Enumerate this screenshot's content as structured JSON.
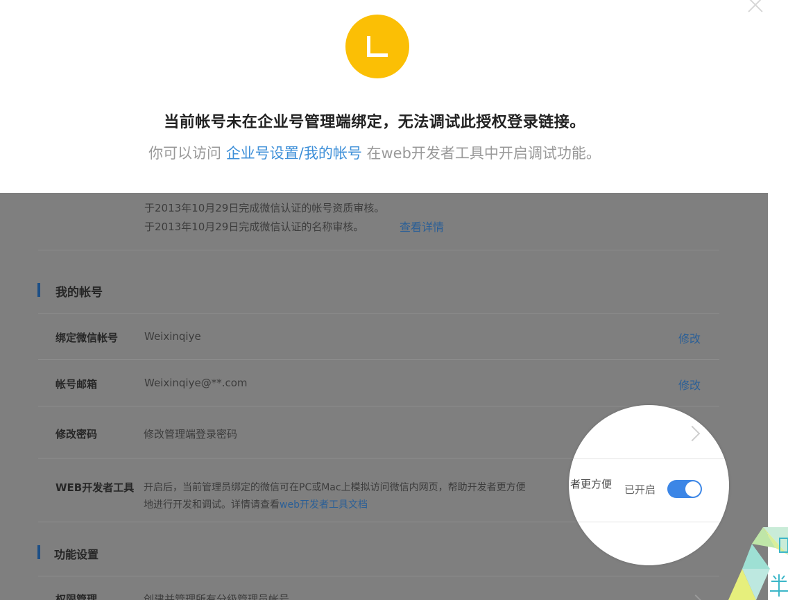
{
  "dialog": {
    "avatar_letter": "L",
    "main_message": "当前帐号未在企业号管理端绑定，无法调试此授权登录链接。",
    "sub_prefix": "你可以访问 ",
    "sub_link": "企业号设置/我的帐号",
    "sub_suffix": " 在web开发者工具中开启调试功能。"
  },
  "panel": {
    "cert_line1": "于2013年10月29日完成微信认证的帐号资质审核。",
    "cert_line2": "于2013年10月29日完成微信认证的名称审核。",
    "cert_link": "查看详情",
    "section_account": "我的帐号",
    "rows": [
      {
        "label": "绑定微信帐号",
        "value": "Weixinqiye",
        "action": "修改"
      },
      {
        "label": "帐号邮箱",
        "value": "Weixinqiye@**.com",
        "action": "修改"
      },
      {
        "label": "修改密码",
        "value": "修改管理端登录密码"
      }
    ],
    "devtools": {
      "label": "WEB开发者工具",
      "desc_line1": "开启后，当前管理员绑定的微信可在PC或Mac上模拟访问微信内网页，帮助开发者更方便",
      "desc_line2_prefix": "地进行开发和调试。详情请查看",
      "desc_link": "web开发者工具文档",
      "status": "已开启"
    },
    "section_features": "功能设置",
    "partial_row": {
      "label": "权限管理",
      "value": "创建并管理所有分级管理员帐号"
    }
  },
  "magnifier": {
    "desc_fragment": "者更方便",
    "status": "已开启"
  },
  "colors": {
    "avatar": "#fbbf05",
    "link": "#3d8fd8",
    "toggle": "#3c86e6",
    "panel_overlay": "#7f7f7f"
  }
}
